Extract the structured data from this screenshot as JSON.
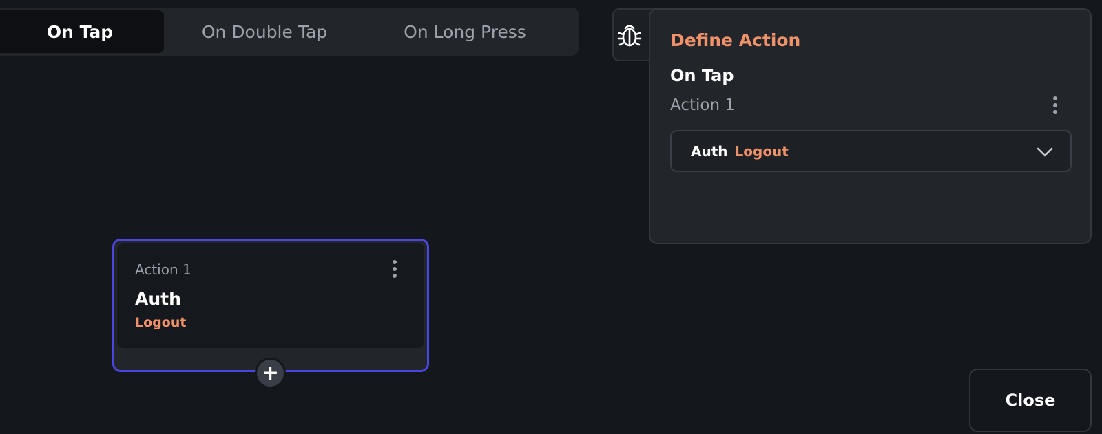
{
  "tabs": [
    {
      "label": "On Tap",
      "active": true
    },
    {
      "label": "On Double Tap",
      "active": false
    },
    {
      "label": "On Long Press",
      "active": false
    }
  ],
  "debug": {
    "icon": "bug-icon"
  },
  "node": {
    "label": "Action 1",
    "title": "Auth",
    "subtitle": "Logout",
    "menu_icon": "more-vertical-icon",
    "add_icon": "plus-icon"
  },
  "panel": {
    "title": "Define Action",
    "trigger": "On Tap",
    "action_label": "Action 1",
    "menu_icon": "more-vertical-icon",
    "dropdown": {
      "category": "Auth",
      "action": "Logout",
      "icon": "chevron-down-icon"
    }
  },
  "close_label": "Close",
  "colors": {
    "accent": "#f0916a",
    "selection_border": "#4a46e0",
    "background": "#14171b"
  }
}
